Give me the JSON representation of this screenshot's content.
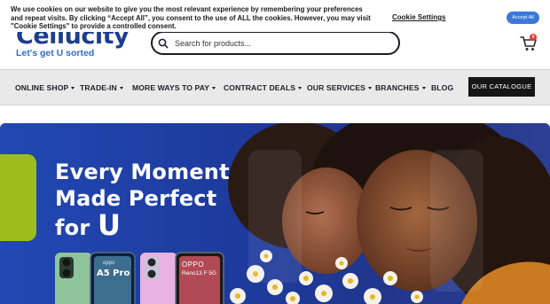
{
  "cookie_banner": {
    "text": "We use cookies on our website to give you the most relevant experience by remembering your preferences and repeat visits. By clicking “Accept All”, you consent to the use of ALL the cookies. However, you may visit \"Cookie Settings\" to provide a controlled consent.",
    "settings_label": "Cookie Settings",
    "accept_label": "Accept All"
  },
  "header": {
    "logo_text": "Cellucity",
    "logo_tagline": "Let's get U sorted",
    "search_placeholder": "Search for products...",
    "cart_count": "0"
  },
  "nav": {
    "items": [
      {
        "label": "ONLINE SHOP",
        "has_dropdown": true
      },
      {
        "label": "TRADE-IN",
        "has_dropdown": true
      },
      {
        "label": "MORE WAYS TO PAY",
        "has_dropdown": true
      },
      {
        "label": "CONTRACT DEALS",
        "has_dropdown": true
      },
      {
        "label": "OUR SERVICES",
        "has_dropdown": true
      },
      {
        "label": "BRANCHES",
        "has_dropdown": true
      },
      {
        "label": "BLOG",
        "has_dropdown": false
      }
    ],
    "catalogue_label": "OUR CATALOGUE"
  },
  "hero": {
    "headline_line1": "Every Moment",
    "headline_line2": "Made Perfect",
    "headline_line3": "for",
    "headline_u": "U",
    "phone1_label": "A5 Pro",
    "phone1_brand": "oppo",
    "phone2_brand": "OPPO",
    "phone2_label": "Reno13 F 5G"
  },
  "colors": {
    "brand_blue": "#1b3e8f",
    "hero_blue": "#1f3b9b",
    "accent_green": "#9bbd1d",
    "accept_blue": "#3b79d8"
  }
}
